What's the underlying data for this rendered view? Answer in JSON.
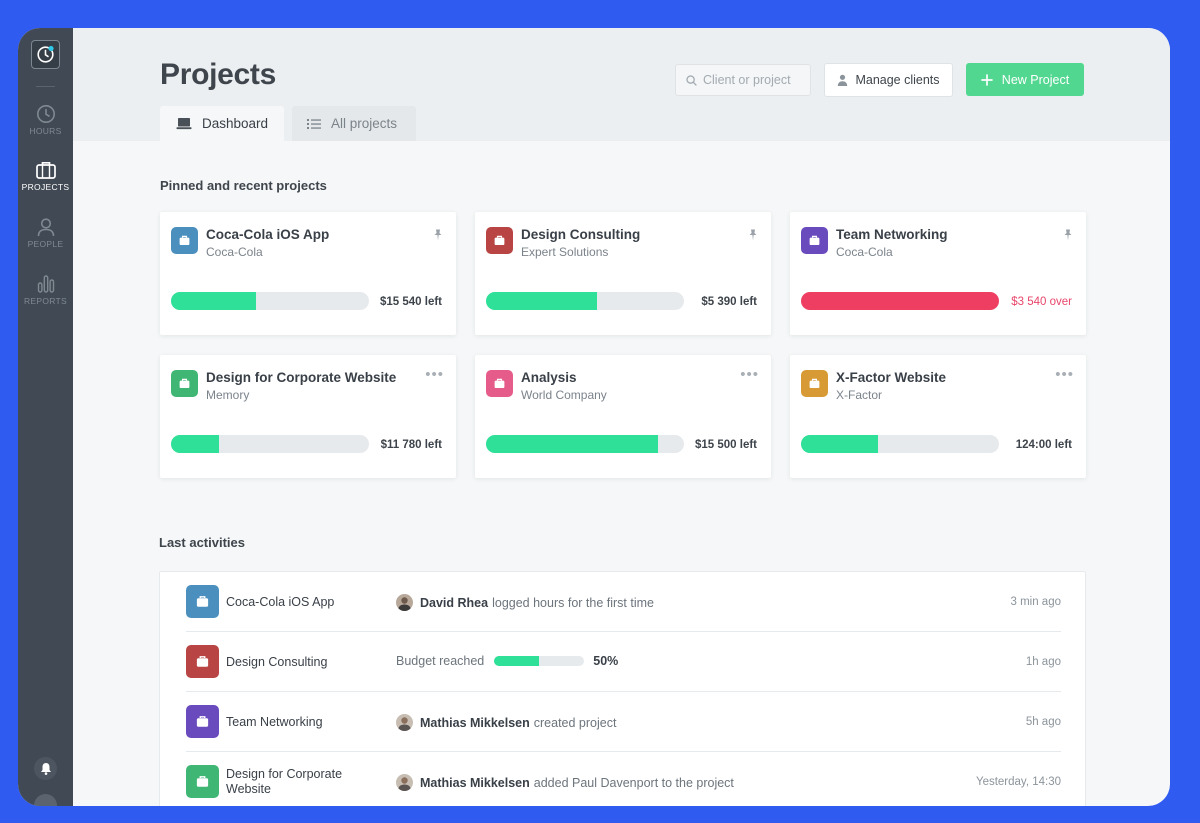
{
  "sidebar": {
    "items": [
      {
        "label": "HOURS",
        "icon": "clock-icon"
      },
      {
        "label": "PROJECTS",
        "icon": "briefcase-icon",
        "active": true
      },
      {
        "label": "PEOPLE",
        "icon": "person-icon"
      },
      {
        "label": "REPORTS",
        "icon": "bar-chart-icon"
      }
    ]
  },
  "header": {
    "title": "Projects",
    "search_placeholder": "Client or project",
    "manage_clients": "Manage clients",
    "new_project": "New Project",
    "tabs": [
      {
        "label": "Dashboard",
        "active": true
      },
      {
        "label": "All projects",
        "active": false
      }
    ]
  },
  "pinned": {
    "title": "Pinned and recent projects",
    "cards": [
      {
        "name": "Coca-Cola iOS App",
        "client": "Coca-Cola",
        "color": "#4a8fbd",
        "progress": 0.43,
        "budget": "$15 540 left",
        "over": false,
        "pinned": true
      },
      {
        "name": "Design Consulting",
        "client": "Expert Solutions",
        "color": "#b84444",
        "progress": 0.56,
        "budget": "$5 390 left",
        "over": false,
        "pinned": true
      },
      {
        "name": "Team Networking",
        "client": "Coca-Cola",
        "color": "#6a4bbd",
        "progress": 1.0,
        "budget": "$3 540 over",
        "over": true,
        "pinned": true
      },
      {
        "name": "Design for Corporate Website",
        "client": "Memory",
        "color": "#3fb673",
        "progress": 0.24,
        "budget": "$11 780 left",
        "over": false,
        "pinned": false
      },
      {
        "name": "Analysis",
        "client": "World Company",
        "color": "#e55c8b",
        "progress": 0.87,
        "budget": "$15 500 left",
        "over": false,
        "pinned": false
      },
      {
        "name": "X-Factor Website",
        "client": "X-Factor",
        "color": "#d79a34",
        "progress": 0.39,
        "budget": "124:00 left",
        "over": false,
        "pinned": false
      }
    ]
  },
  "activities": {
    "title": "Last activities",
    "rows": [
      {
        "project": "Coca-Cola iOS App",
        "color": "#4a8fbd",
        "person": "David Rhea",
        "text": "logged hours for the first time",
        "time": "3 min ago"
      },
      {
        "project": "Design Consulting",
        "color": "#b84444",
        "budget_label": "Budget reached",
        "progress": 0.5,
        "pct": "50%",
        "time": "1h ago"
      },
      {
        "project": "Team Networking",
        "color": "#6a4bbd",
        "person": "Mathias Mikkelsen",
        "text": "created project",
        "time": "5h ago"
      },
      {
        "project": "Design for Corporate Website",
        "color": "#3fb673",
        "person": "Mathias Mikkelsen",
        "text": "added Paul Davenport to the project",
        "time": "Yesterday, 14:30"
      }
    ]
  }
}
